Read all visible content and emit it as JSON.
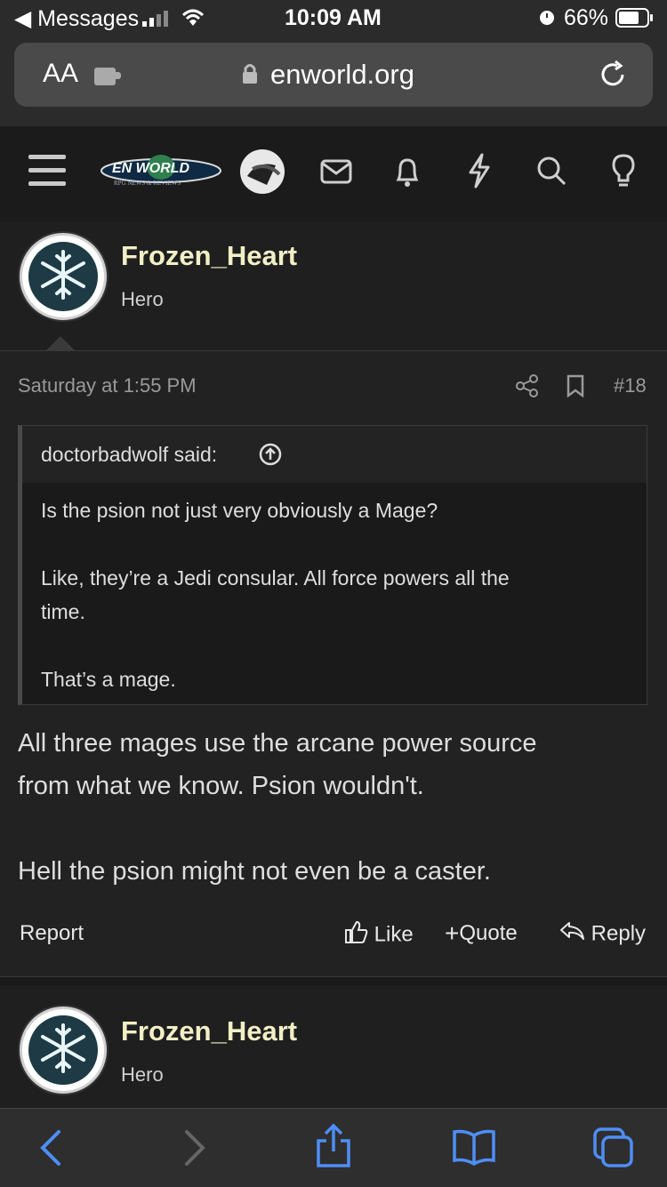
{
  "status_bar": {
    "back_app": "Messages",
    "time": "10:09 AM",
    "battery": "66%"
  },
  "browser": {
    "text_size_label": "AA",
    "url": "enworld.org"
  },
  "site_header": {
    "logo_text": "EN WORLD",
    "logo_subtext": "RPG NEWS & REVIEWS"
  },
  "post": {
    "username": "Frozen_Heart",
    "user_title": "Hero",
    "date": "Saturday at 1:55 PM",
    "post_number": "#18",
    "quote": {
      "author_label": "doctorbadwolf said:",
      "lines": [
        "Is the psion not just very obviously a Mage?",
        "Like, they’re a Jedi consular. All force powers all the",
        "time.",
        "That’s a mage."
      ]
    },
    "body_lines": [
      "All three mages use the arcane power source",
      "from what we know. Psion wouldn't.",
      "Hell the psion might not even be a caster."
    ],
    "actions": {
      "report": "Report",
      "like": "Like",
      "quote": "Quote",
      "reply": "Reply"
    }
  },
  "next_post": {
    "username": "Frozen_Heart",
    "user_title": "Hero"
  },
  "colors": {
    "background": "#232323",
    "username": "#f2efc6",
    "toolbar_icon": "#4f8ef7"
  }
}
